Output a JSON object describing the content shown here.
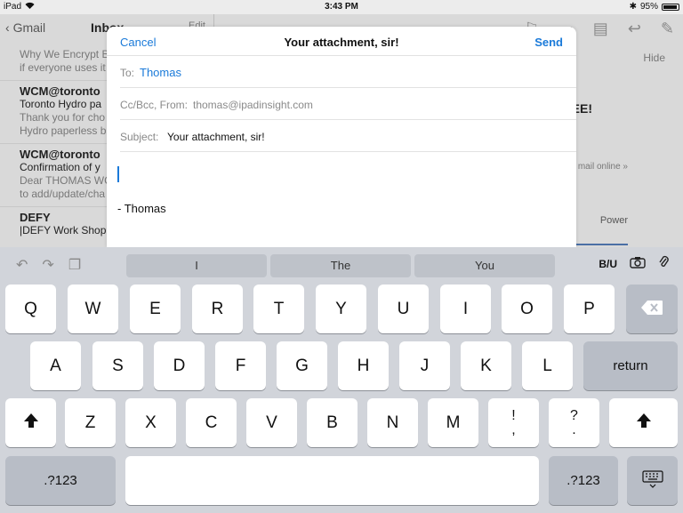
{
  "status_bar": {
    "device": "iPad",
    "time": "3:43 PM",
    "battery": "95%"
  },
  "background": {
    "nav_back": "Gmail",
    "nav_title": "Inbox",
    "nav_edit": "Edit",
    "list": [
      {
        "from": "",
        "subject": "Why We Encrypt B",
        "preview": "if everyone uses it"
      },
      {
        "from": "WCM@toronto",
        "subject": "Toronto Hydro pa",
        "preview": "Thank you for cho",
        "preview2": "Hydro paperless b"
      },
      {
        "from": "WCM@toronto",
        "subject": "Confirmation of y",
        "preview": "Dear THOMAS WC",
        "preview2": "to add/update/cha"
      },
      {
        "from": "DEFY",
        "subject": "|DEFY Work Shop",
        "preview": ""
      }
    ],
    "hide": "Hide",
    "banner_text": "EE!",
    "mail_online": "mail online »",
    "power": "Power"
  },
  "compose": {
    "cancel": "Cancel",
    "title": "Your attachment, sir!",
    "send": "Send",
    "to_label": "To:",
    "to_value": "Thomas",
    "cc_label": "Cc/Bcc, From:",
    "cc_value": "thomas@ipadinsight.com",
    "subject_label": "Subject:",
    "subject_value": "Your attachment, sir!",
    "signature": "- Thomas"
  },
  "keyboard": {
    "suggestions": [
      "I",
      "The",
      "You"
    ],
    "format_label": "B/U",
    "row1": [
      "Q",
      "W",
      "E",
      "R",
      "T",
      "Y",
      "U",
      "I",
      "O",
      "P"
    ],
    "row2": [
      "A",
      "S",
      "D",
      "F",
      "G",
      "H",
      "J",
      "K",
      "L"
    ],
    "row3": [
      "Z",
      "X",
      "C",
      "V",
      "B",
      "N",
      "M"
    ],
    "punct1": [
      "!",
      ","
    ],
    "punct2": [
      "?",
      "."
    ],
    "return": "return",
    "numbers": ".?123"
  }
}
